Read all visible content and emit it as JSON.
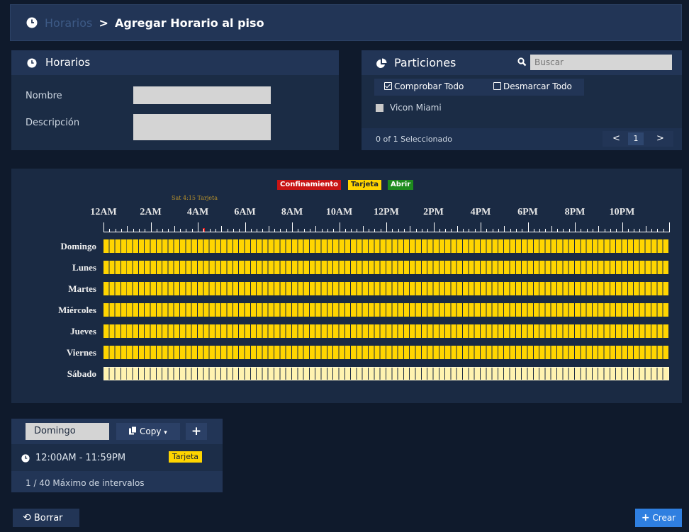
{
  "breadcrumb": {
    "parent": "Horarios",
    "current": "Agregar Horario al piso"
  },
  "horarios_panel": {
    "title": "Horarios",
    "nombre_label": "Nombre",
    "nombre_value": "",
    "descripcion_label": "Descripción",
    "descripcion_value": ""
  },
  "particiones_panel": {
    "title": "Particiones",
    "search_placeholder": "Buscar",
    "check_all": "Comprobar Todo",
    "uncheck_all": "Desmarcar Todo",
    "items": [
      {
        "label": "Vicon Miami",
        "checked": false
      }
    ],
    "selected_count": "0 of 1 Seleccionado",
    "page": "1",
    "prev": "<",
    "next": ">"
  },
  "schedule": {
    "legend": [
      {
        "label": "Confinamiento",
        "color": "#c81414",
        "text_color": "#ffffff"
      },
      {
        "label": "Tarjeta",
        "color": "#ffd500",
        "text_color": "#1b2433"
      },
      {
        "label": "Abrir",
        "color": "#1e8b1e",
        "text_color": "#ffffff"
      }
    ],
    "hover_label": "Sat 4:15 Tarjeta",
    "hour_labels": [
      "12AM",
      "2AM",
      "4AM",
      "6AM",
      "8AM",
      "10AM",
      "12PM",
      "2PM",
      "4PM",
      "6PM",
      "8PM",
      "10PM"
    ],
    "marker_hour": 4.25,
    "days": [
      {
        "label": "Domingo",
        "mode": "Tarjeta",
        "style": "solid"
      },
      {
        "label": "Lunes",
        "mode": "Tarjeta",
        "style": "solid"
      },
      {
        "label": "Martes",
        "mode": "Tarjeta",
        "style": "solid"
      },
      {
        "label": "Miércoles",
        "mode": "Tarjeta",
        "style": "solid"
      },
      {
        "label": "Jueves",
        "mode": "Tarjeta",
        "style": "solid"
      },
      {
        "label": "Viernes",
        "mode": "Tarjeta",
        "style": "solid"
      },
      {
        "label": "Sábado",
        "mode": "Tarjeta",
        "style": "light"
      }
    ],
    "colors": {
      "tarjeta": "#ffd500",
      "tarjeta_light": "#fff3b0",
      "grid": "#1a2a43"
    }
  },
  "intervals_panel": {
    "day_selected": "Domingo",
    "copy_label": "Copy",
    "add_label": "+",
    "interval_text": "12:00AM - 11:59PM",
    "interval_badge": "Tarjeta",
    "max_text": "1 / 40 Máximo de intervalos"
  },
  "footer": {
    "borrar": "Borrar",
    "crear": "Crear"
  },
  "icons": {
    "breadcrumb": "clock-icon",
    "horarios": "clock-icon",
    "particiones": "pie-chart-icon",
    "search": "search-icon",
    "copy": "copy-icon",
    "borrar": "undo-icon",
    "crear": "plus-icon"
  }
}
